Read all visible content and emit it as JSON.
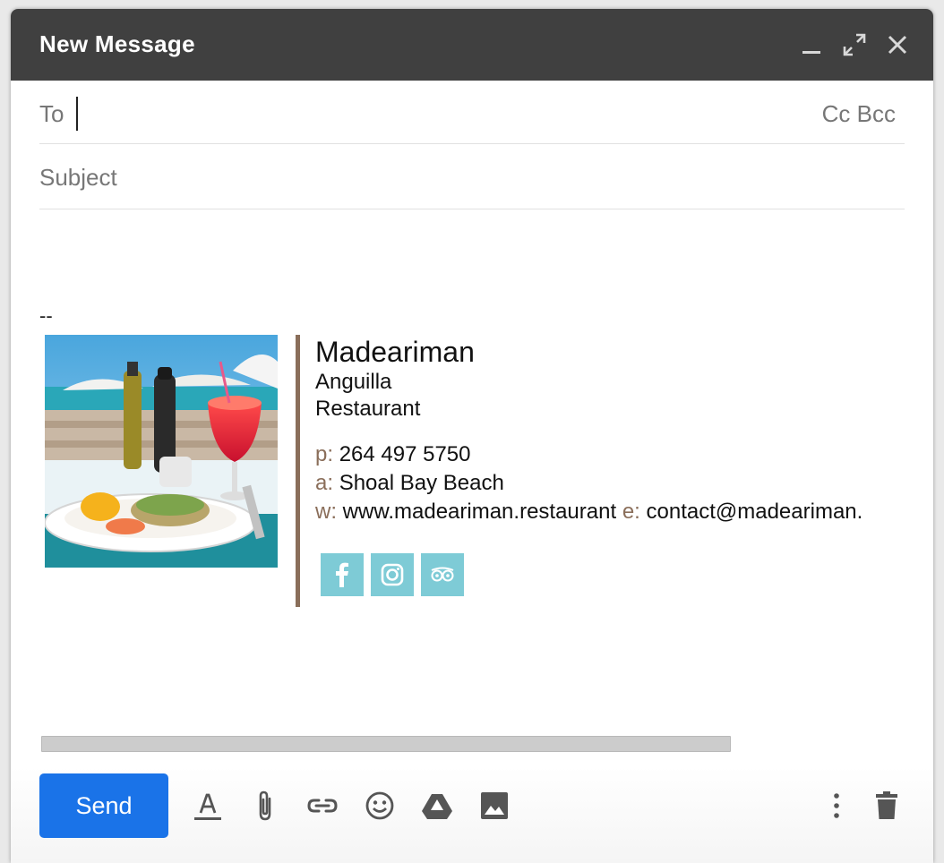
{
  "window": {
    "title": "New Message",
    "controls": [
      "minimize-icon",
      "expand-icon",
      "close-icon"
    ]
  },
  "compose": {
    "to_label": "To",
    "to_value": "",
    "cc_label": "Cc",
    "bcc_label": "Bcc",
    "subject_placeholder": "Subject"
  },
  "signature": {
    "separator": "--",
    "name": "Madeariman",
    "line1": "Anguilla",
    "line2": "Restaurant",
    "phone_label": "p:",
    "phone": "264 497 5750",
    "address_label": "a:",
    "address": "Shoal Bay Beach",
    "web_label": "w:",
    "web": "www.madeariman.restaurant",
    "email_label": "e:",
    "email": "contact@madeariman.",
    "social": [
      "facebook-icon",
      "instagram-icon",
      "tripadvisor-icon"
    ],
    "accent_color": "#8a6e5a",
    "social_color": "#7ecbd6"
  },
  "toolbar": {
    "send_label": "Send",
    "icons": [
      "text-format-icon",
      "attach-icon",
      "link-icon",
      "emoji-icon",
      "drive-icon",
      "image-icon",
      "more-options-icon",
      "trash-icon"
    ],
    "send_color": "#1a73e8"
  }
}
